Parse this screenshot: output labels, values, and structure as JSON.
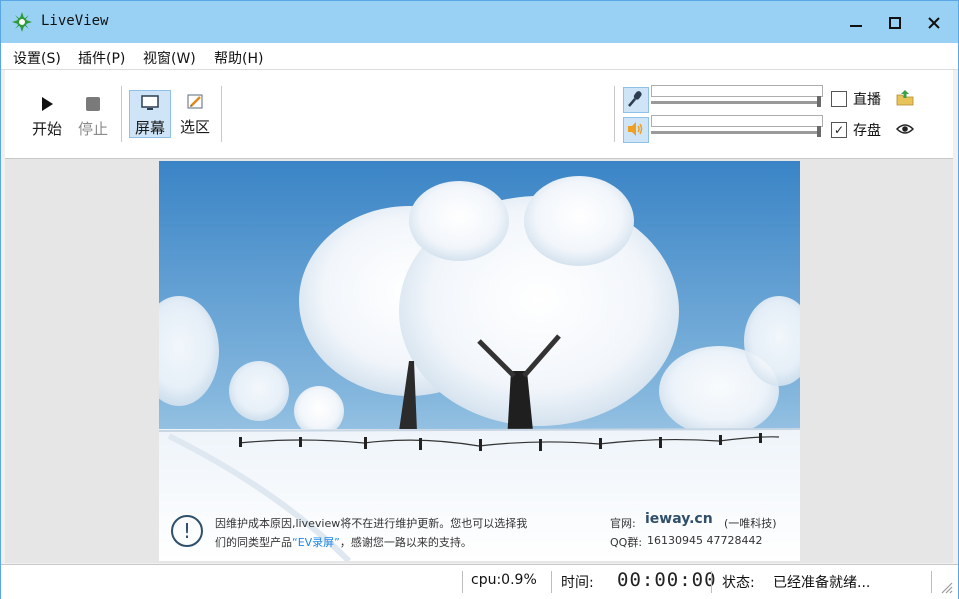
{
  "window": {
    "title": "LiveView",
    "minimize": "—",
    "maximize": "☐",
    "close": "✕"
  },
  "menu": {
    "items": [
      "设置(S)",
      "插件(P)",
      "视窗(W)",
      "帮助(H)"
    ]
  },
  "toolbar": {
    "start_label": "开始",
    "stop_label": "停止",
    "screen_label": "屏幕",
    "region_label": "选区",
    "mic_level": 1.0,
    "speaker_level": 1.0,
    "live_label": "直播",
    "live_checked": false,
    "save_label": "存盘",
    "save_checked": true,
    "check_mark": "✓"
  },
  "preview": {
    "notice_line1": "因维护成本原因,liveview将不在进行维护更新。您也可以选择我",
    "notice_line2_prefix": "们的同类型产品",
    "notice_line2_product": "“EV录屏”",
    "notice_line2_suffix": "，感谢您一路以来的支持。",
    "website_label": "官网:",
    "website": "ieway.cn",
    "company": "(一唯科技)",
    "qq_label": "QQ群:",
    "qq_groups": "16130945  47728442",
    "notice_icon": "!"
  },
  "status": {
    "cpu": "cpu:0.9%",
    "time_label": "时间:",
    "time_value": "00:00:00",
    "state_label": "状态:",
    "state_value": "已经准备就绪..."
  },
  "colors": {
    "titlebar": "#99d1f5",
    "accent": "#1e88e5",
    "sky": "#3f88c8"
  }
}
